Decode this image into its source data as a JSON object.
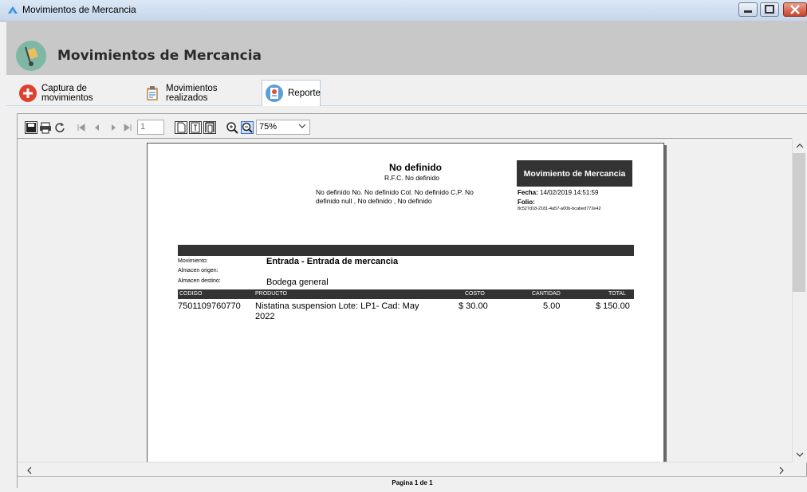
{
  "window": {
    "title": "Movimientos de Mercancia"
  },
  "header": {
    "title": "Movimientos de Mercancia"
  },
  "tabs": [
    {
      "label": "Captura de movimientos"
    },
    {
      "label": "Movimientos realizados"
    },
    {
      "label": "Reporte"
    }
  ],
  "toolbar": {
    "page_value": "1",
    "zoom_value": "75%"
  },
  "report": {
    "company": "No definido",
    "rfc": "R.F.C. No definido",
    "address_line1": "No definido  No. No definido  Col. No definido  C.P. No",
    "address_line2": "definido null , No definido , No definido",
    "doc_title": "Movimiento de Mercancia",
    "fecha_label": "Fecha:",
    "fecha_value": "14/02/2019 14:51:59",
    "folio_label": "Folio:",
    "folio_value": "8c527d18-2181-4a57-a00b-bcabed772e42",
    "labels": {
      "movimiento": "Movimiento:",
      "origen": "Almacen origen:",
      "destino": "Almacen destino:"
    },
    "values": {
      "movimiento": "Entrada - Entrada de mercancia",
      "origen": "",
      "destino": "Bodega general"
    },
    "columns": [
      "CODIGO",
      "PRODUCTO",
      "COSTO",
      "CANTIDAD",
      "TOTAL"
    ],
    "rows": [
      {
        "codigo": "7501109760770",
        "producto_1": "Nistatina suspension  Lote: LP1- Cad: May",
        "producto_2": "2022",
        "costo": "$ 30.00",
        "cantidad": "5.00",
        "total": "$ 150.00"
      }
    ]
  },
  "status": {
    "page_text": "Pagina 1 de 1"
  },
  "colors": {
    "header_bg": "#c8c8c8",
    "report_dark": "#333333",
    "tab_add_icon": "#e04030"
  }
}
